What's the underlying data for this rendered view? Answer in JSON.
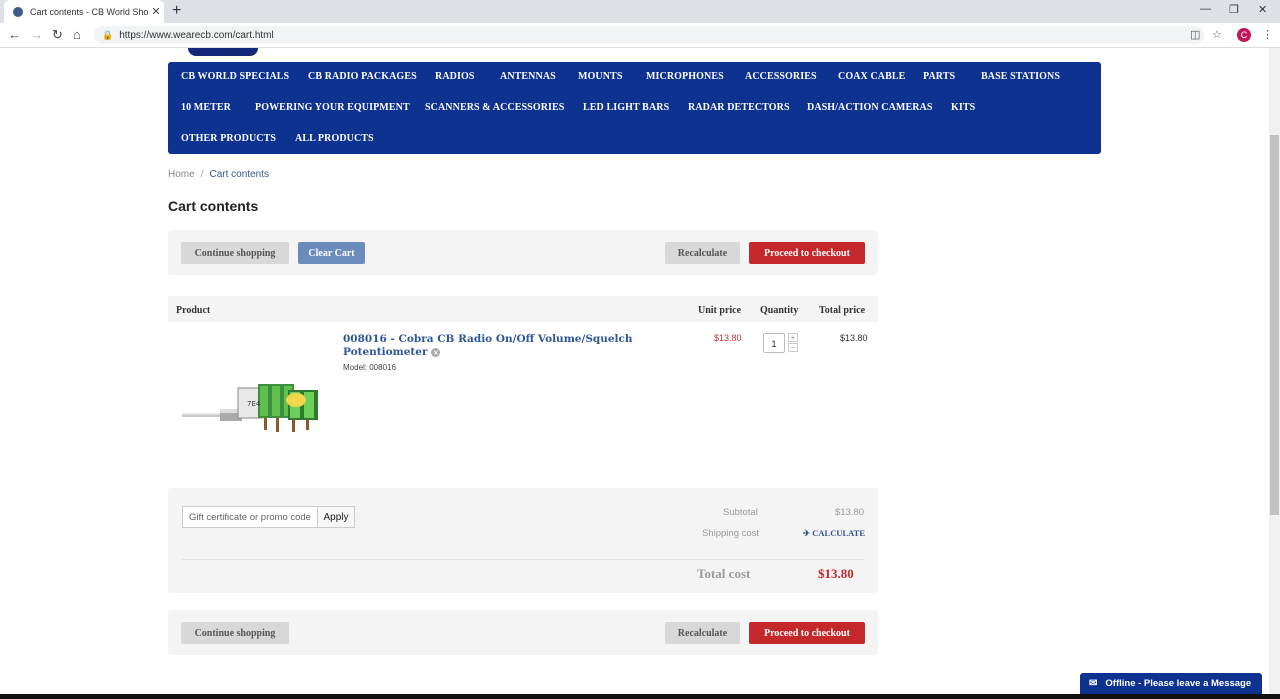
{
  "browser": {
    "tab_title": "Cart contents - CB World Shopp",
    "tab_close": "✕",
    "new_tab": "+",
    "url": "https://www.wearecb.com/cart.html",
    "avatar_letter": "C"
  },
  "nav": {
    "row1": [
      "CB WORLD SPECIALS",
      "CB RADIO PACKAGES",
      "RADIOS",
      "ANTENNAS",
      "MOUNTS",
      "MICROPHONES",
      "ACCESSORIES",
      "COAX CABLE",
      "PARTS",
      "BASE STATIONS"
    ],
    "row2": [
      "10 METER",
      "POWERING YOUR EQUIPMENT",
      "SCANNERS & ACCESSORIES",
      "LED LIGHT BARS",
      "RADAR DETECTORS",
      "DASH/ACTION CAMERAS",
      "KITS"
    ],
    "row3": [
      "OTHER PRODUCTS",
      "ALL PRODUCTS"
    ]
  },
  "breadcrumb": {
    "home": "Home",
    "separator": "/",
    "current": "Cart contents"
  },
  "page_title": "Cart contents",
  "buttons": {
    "continue_shopping": "Continue shopping",
    "clear_cart": "Clear Cart",
    "recalculate": "Recalculate",
    "proceed_checkout": "Proceed to checkout"
  },
  "table": {
    "headers": {
      "product": "Product",
      "unit_price": "Unit price",
      "quantity": "Quantity",
      "total_price": "Total price"
    },
    "items": [
      {
        "name": "008016 - Cobra CB Radio On/Off Volume/Squelch Potentiometer",
        "model": "Model: 008016",
        "unit_price": "$13.80",
        "quantity": "1",
        "total_price": "$13.80"
      }
    ]
  },
  "promo": {
    "placeholder": "Gift certificate or promo code",
    "apply": "Apply"
  },
  "summary": {
    "subtotal_label": "Subtotal",
    "subtotal_value": "$13.80",
    "shipping_label": "Shipping cost",
    "calculate": "CALCULATE",
    "total_label": "Total cost",
    "total_value": "$13.80"
  },
  "chat": {
    "label": "Offline - Please leave a Message"
  },
  "colors": {
    "nav_bg": "#0d3290",
    "checkout_red": "#c5282a",
    "clear_blue": "#6d8cbe",
    "link_blue": "#2f5597"
  }
}
